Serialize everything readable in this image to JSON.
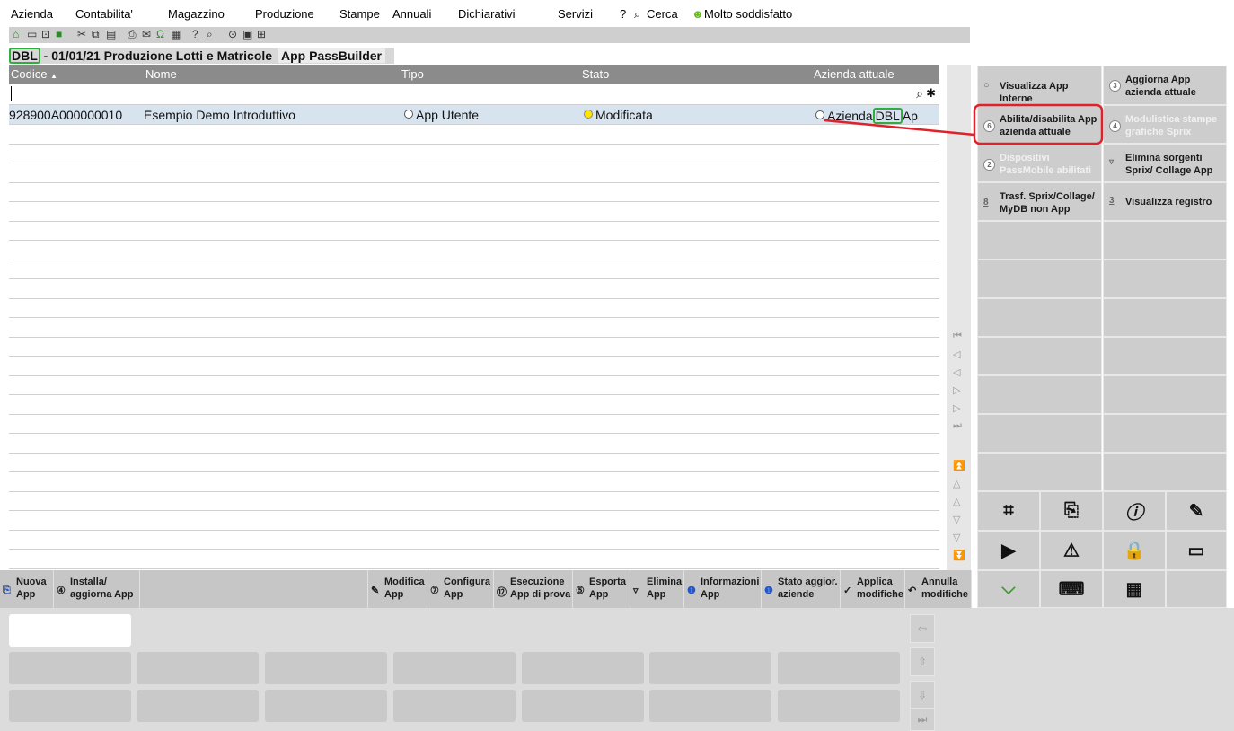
{
  "menu": [
    "Azienda",
    "Contabilita'",
    "Magazzino",
    "Produzione",
    "Stampe",
    "Annuali",
    "Dichiarativi",
    "Servizi",
    "?",
    "Cerca",
    "Molto soddisfatto"
  ],
  "title": {
    "company": "DBL",
    "rest": "- 01/01/21 Produzione Lotti e Matricole",
    "app": "App PassBuilder"
  },
  "columns": {
    "codice": "Codice",
    "nome": "Nome",
    "tipo": "Tipo",
    "stato": "Stato",
    "azienda": "Azienda attuale",
    "sort_indicator": "▲"
  },
  "rows": [
    {
      "codice": "928900A000000010",
      "nome": "Esempio Demo Introduttivo",
      "tipo": "App Utente",
      "stato": "Modificata",
      "azienda_pre": "Azienda",
      "azienda_code": "DBL",
      "azienda_post": "Ap"
    }
  ],
  "right_panel": [
    {
      "label": "Visualizza App Interne",
      "key": "",
      "enabled": true
    },
    {
      "label": "Aggiorna App azienda attuale",
      "key": "3",
      "enabled": true
    },
    {
      "label": "Abilita/disabilita App azienda attuale",
      "key": "6",
      "enabled": true
    },
    {
      "label": "Modulistica stampe grafiche Sprix",
      "key": "4",
      "enabled": false
    },
    {
      "label": "Dispositivi PassMobile abilitati",
      "key": "2",
      "enabled": false
    },
    {
      "label": "Elimina sorgenti Sprix/ Collage App",
      "key": "",
      "enabled": true
    },
    {
      "label": "Trasf. Sprix/Collage/ MyDB non App",
      "key": "8",
      "enabled": true
    },
    {
      "label": "Visualizza registro",
      "key": "3",
      "enabled": true
    }
  ],
  "command_bar": [
    {
      "label": "Nuova App",
      "icon": "new-app-icon"
    },
    {
      "label": "Installa/ aggiorna App",
      "icon": "install-icon"
    },
    {
      "label": "Modifica App",
      "icon": "pencil-icon"
    },
    {
      "label": "Configura App",
      "icon": "configure-icon"
    },
    {
      "label": "Esecuzione App di prova",
      "icon": "run-icon"
    },
    {
      "label": "Esporta App",
      "icon": "export-icon"
    },
    {
      "label": "Elimina App",
      "icon": "trash-icon"
    },
    {
      "label": "Informazioni App",
      "icon": "info-icon"
    },
    {
      "label": "Stato aggior. aziende",
      "icon": "info-icon"
    },
    {
      "label": "Applica modifiche",
      "icon": "check-icon"
    },
    {
      "label": "Annulla modifiche",
      "icon": "undo-icon"
    }
  ],
  "colors": {
    "highlight_green": "#2fae3e",
    "annotation_red": "#e0202a",
    "header_gray": "#8b8b8b",
    "selected_row": "#d7e3ef",
    "panel_gray": "#cdcdcd"
  }
}
